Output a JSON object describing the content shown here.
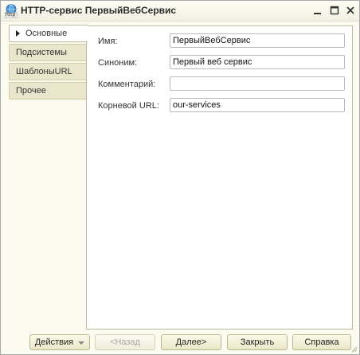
{
  "window": {
    "title": "HTTP-сервис ПервыйВебСервис",
    "icon_name": "http-service-icon",
    "icon_caption": "http"
  },
  "tabs": [
    {
      "label": "Основные",
      "active": true
    },
    {
      "label": "Подсистемы",
      "active": false
    },
    {
      "label": "ШаблоныURL",
      "active": false
    },
    {
      "label": "Прочее",
      "active": false
    }
  ],
  "form": {
    "name": {
      "label": "Имя:",
      "value": "ПервыйВебСервис"
    },
    "synonym": {
      "label": "Синоним:",
      "value": "Первый веб сервис"
    },
    "comment": {
      "label": "Комментарий:",
      "value": ""
    },
    "root_url": {
      "label": "Корневой URL:",
      "value": "our-services"
    }
  },
  "buttons": {
    "actions": "Действия",
    "back": "<Назад",
    "next": "Далее>",
    "close": "Закрыть",
    "help": "Справка"
  },
  "colors": {
    "window_bg": "#fbfbef",
    "tab_bg": "#e9e6cc",
    "border": "#bdbaa0"
  }
}
